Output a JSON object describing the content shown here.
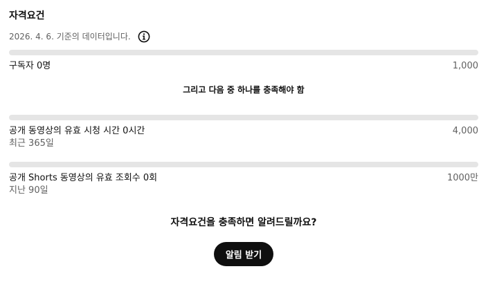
{
  "section": {
    "title": "자격요건",
    "as_of": "2026. 4. 6. 기준의 데이터입니다.",
    "info_icon": "info-circle-icon"
  },
  "requirements": {
    "subscribers": {
      "label": "구독자 0명",
      "target": "1,000",
      "progress": 0
    },
    "or_text": "그리고 다음 중 하나를 충족해야 함",
    "watch_hours": {
      "label": "공개 동영상의 유효 시청 시간 0시간",
      "period": "최근 365일",
      "target": "4,000",
      "progress": 0
    },
    "shorts_views": {
      "label": "공개 Shorts 동영상의 유효 조회수 0회",
      "period": "지난 90일",
      "target": "1000만",
      "progress": 0
    }
  },
  "notify": {
    "question": "자격요건을 충족하면 알려드릴까요?",
    "button_label": "알림 받기"
  },
  "colors": {
    "track": "#e5e5e5",
    "fill": "#065fd4",
    "button_bg": "#0f0f0f",
    "button_text": "#ffffff",
    "secondary_text": "#606060"
  }
}
